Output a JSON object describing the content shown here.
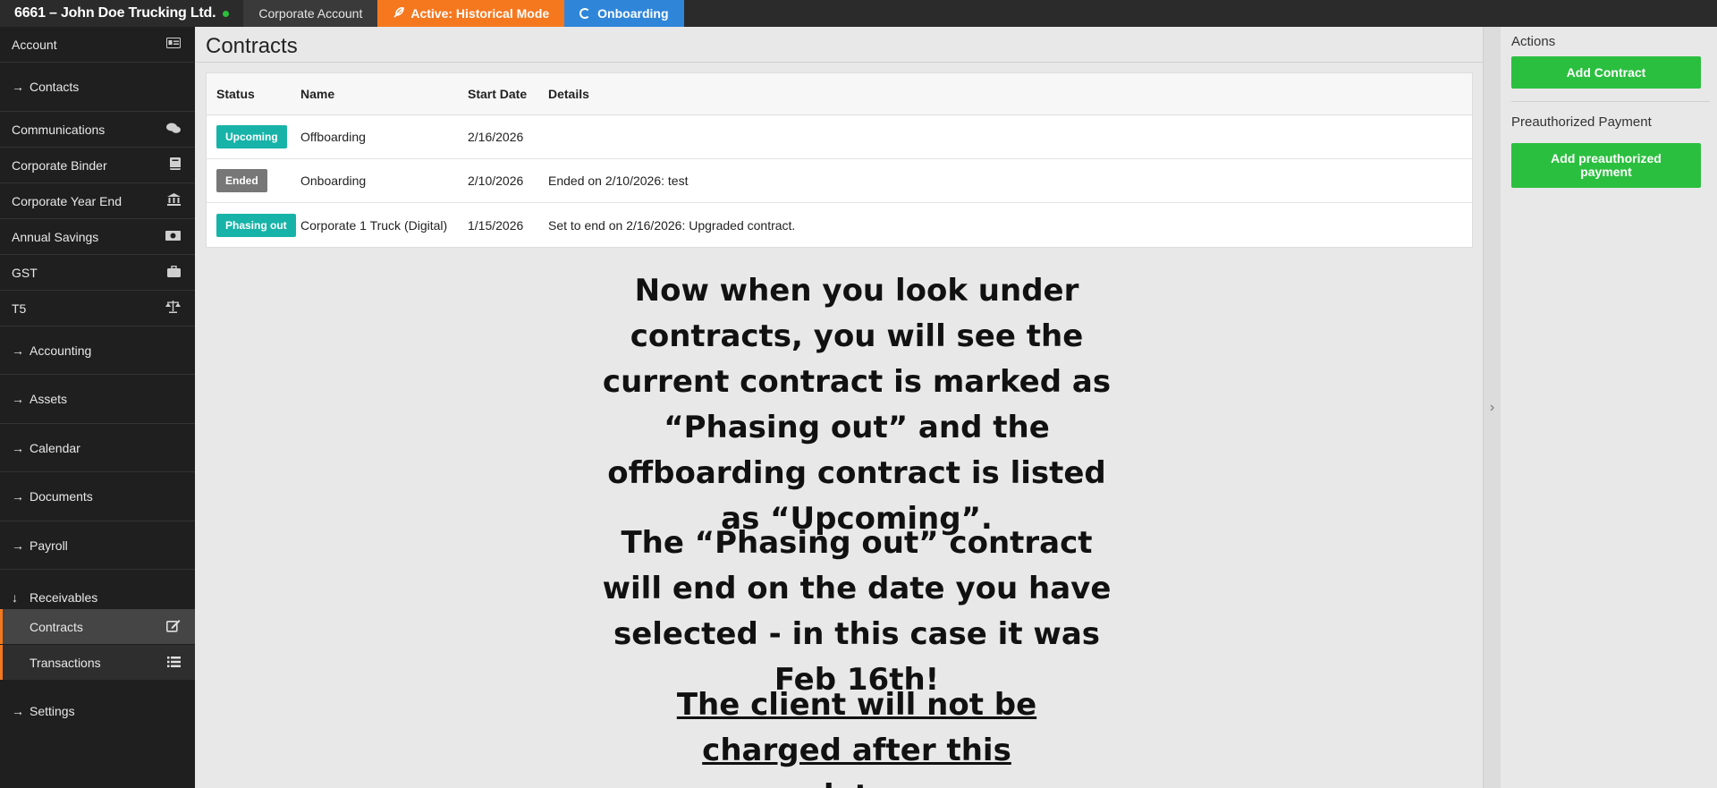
{
  "topbar": {
    "brand": "6661 – John Doe Trucking Ltd.",
    "tabs": [
      {
        "label": "Corporate Account"
      },
      {
        "label": "Active: Historical Mode",
        "color": "#f5781f"
      },
      {
        "label": "Onboarding",
        "color": "#2f86d9"
      }
    ]
  },
  "sidebar": {
    "items": [
      {
        "label": "Account",
        "icon": "id-card-icon"
      },
      {
        "label": "Contacts",
        "icon": "arrow-right-icon"
      },
      {
        "label": "Communications",
        "icon": "comments-icon"
      },
      {
        "label": "Corporate Binder",
        "icon": "book-icon"
      },
      {
        "label": "Corporate Year End",
        "icon": "bank-icon"
      },
      {
        "label": "Annual Savings",
        "icon": "money-icon"
      },
      {
        "label": "GST",
        "icon": "briefcase-icon"
      },
      {
        "label": "T5",
        "icon": "balance-scale-icon"
      },
      {
        "label": "Accounting",
        "icon": "arrow-right-icon"
      },
      {
        "label": "Assets",
        "icon": "arrow-right-icon"
      },
      {
        "label": "Calendar",
        "icon": "arrow-right-icon"
      },
      {
        "label": "Documents",
        "icon": "arrow-right-icon"
      },
      {
        "label": "Payroll",
        "icon": "arrow-right-icon"
      },
      {
        "label": "Receivables",
        "icon": "arrow-down-icon"
      },
      {
        "label": "Contracts",
        "icon": "edit-icon"
      },
      {
        "label": "Transactions",
        "icon": "list-icon"
      },
      {
        "label": "Settings",
        "icon": "arrow-right-icon"
      }
    ]
  },
  "main": {
    "title": "Contracts",
    "columns": [
      "Status",
      "Name",
      "Start Date",
      "Details"
    ],
    "rows": [
      {
        "status": "Upcoming",
        "status_color": "#17b3a8",
        "name": "Offboarding",
        "start": "2/16/2026",
        "details": ""
      },
      {
        "status": "Ended",
        "status_color": "#777777",
        "name": "Onboarding",
        "start": "2/10/2026",
        "details": "Ended on 2/10/2026: test"
      },
      {
        "status": "Phasing out",
        "status_color": "#17b3a8",
        "name": "Corporate 1 Truck (Digital)",
        "start": "1/15/2026",
        "details": "Set to end on 2/16/2026: Upgraded contract."
      }
    ],
    "annotation": {
      "p1": "Now when you look under contracts, you will see the current contract is marked as “Phasing out” and the offboarding contract is listed as “Upcoming”.",
      "p2": "The “Phasing out” contract will end on the date you have selected - in this case it was Feb 16th!",
      "p3": "The client will not be charged after this date."
    }
  },
  "right_panel": {
    "actions_heading": "Actions",
    "add_contract": "Add Contract",
    "preauth_heading": "Preauthorized Payment",
    "add_preauth": "Add preauthorized payment"
  }
}
